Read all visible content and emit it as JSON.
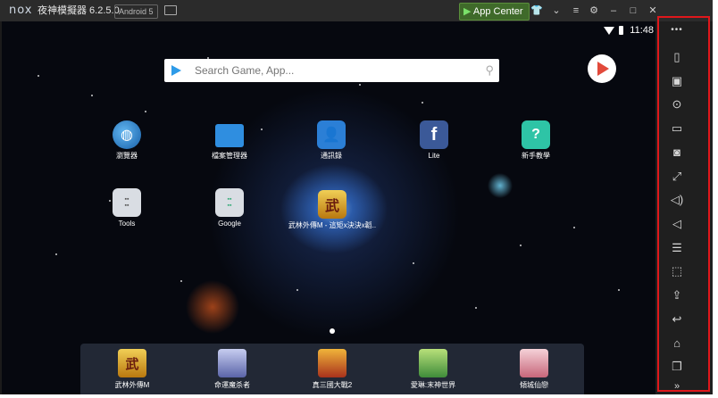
{
  "titlebar": {
    "logo": "nox",
    "title": "夜神模擬器 6.2.5.0",
    "android_version": "Android 5",
    "app_center": "App Center",
    "icons": [
      "shirt-icon",
      "chevron-down-icon",
      "menu-icon",
      "settings-icon",
      "minimize-icon",
      "maximize-icon",
      "close-icon"
    ]
  },
  "status": {
    "time": "11:48"
  },
  "search": {
    "placeholder": "Search Game, App..."
  },
  "desktop_apps": [
    {
      "label": "瀏覽器",
      "icon": "globe-icon",
      "color": "#1f6fb8"
    },
    {
      "label": "檔案管理器",
      "icon": "folder-icon",
      "color": "#2f8ee0"
    },
    {
      "label": "通訊錄",
      "icon": "contacts-icon",
      "color": "#2b7fd6"
    },
    {
      "label": "Lite",
      "icon": "facebook-icon",
      "color": "#3b5998"
    },
    {
      "label": "新手教學",
      "icon": "help-icon",
      "color": "#2ec4a6"
    },
    {
      "label": "Tools",
      "icon": "folder-icon",
      "color": "#d9dde3"
    },
    {
      "label": "Google",
      "icon": "folder-icon",
      "color": "#d9dde3"
    },
    {
      "label": "武林外傳M - 這矩x決決x韜..",
      "icon": "wu-icon",
      "color": "#d49a1f"
    }
  ],
  "dock_apps": [
    {
      "label": "武林外傳M",
      "color": "#c8911c"
    },
    {
      "label": "命運魔杀者",
      "color": "#7a86c8"
    },
    {
      "label": "真三國大戰2",
      "color": "#c9462a"
    },
    {
      "label": "愛琳:末神世界",
      "color": "#5aa84a"
    },
    {
      "label": "傾城仙戀",
      "color": "#d87d8c"
    }
  ],
  "sidebar": {
    "more": "•••",
    "items": [
      "phone-shake-icon",
      "robot-icon",
      "location-icon",
      "keyboard-icon",
      "screenshot-icon",
      "fullscreen-icon",
      "volume-up-icon",
      "volume-down-icon",
      "multi-instance-icon",
      "macro-icon",
      "apk-install-icon",
      "back-icon",
      "home-icon",
      "recent-apps-icon",
      "expand-icon"
    ]
  }
}
